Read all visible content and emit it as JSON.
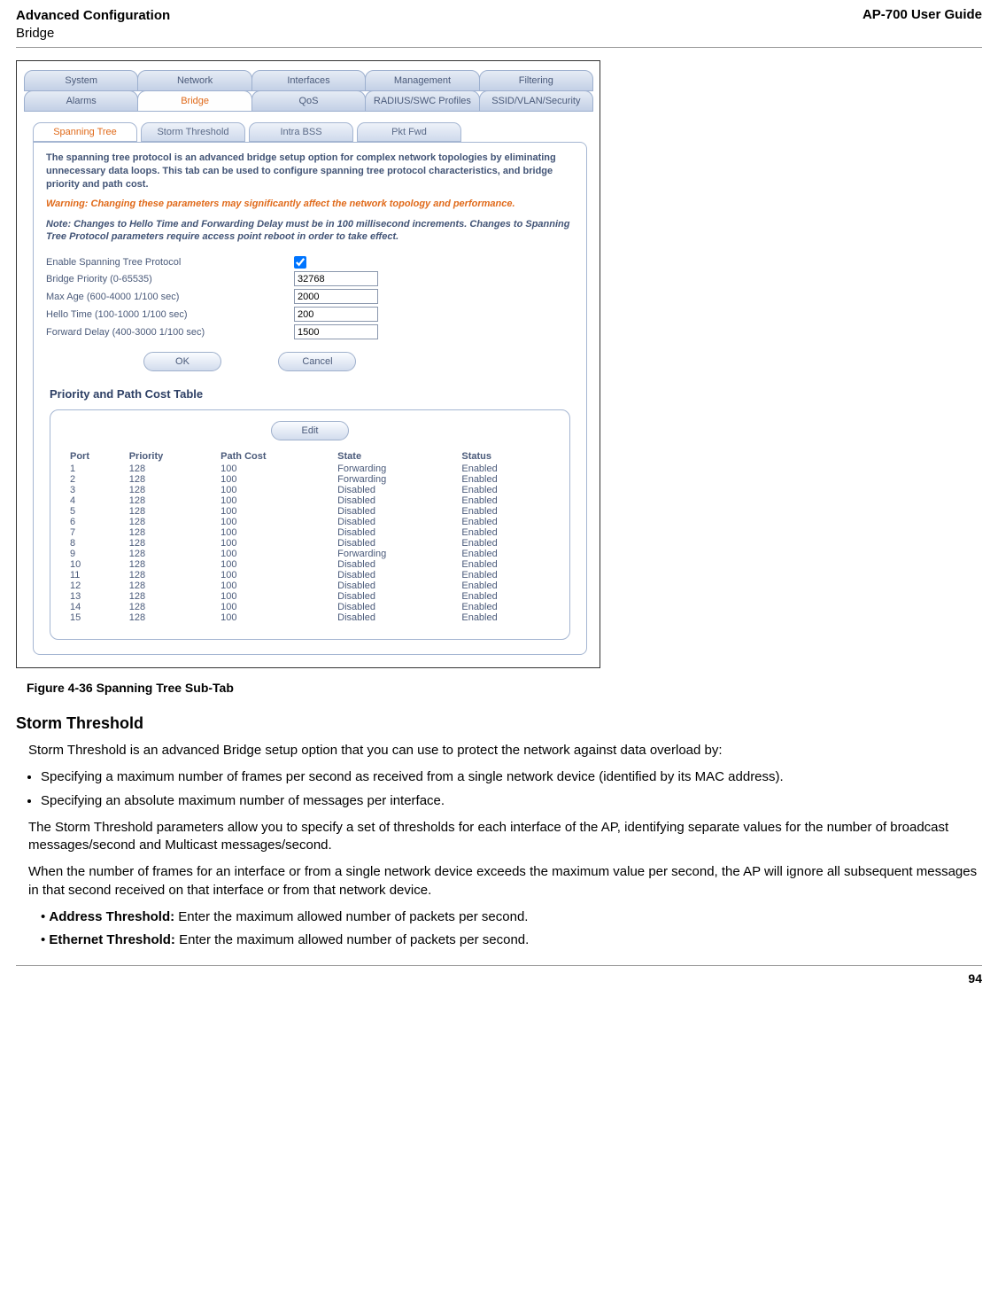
{
  "header": {
    "left_title": "Advanced Configuration",
    "left_sub": "Bridge",
    "right": "AP-700 User Guide"
  },
  "screenshot": {
    "top_tabs_row1": [
      "System",
      "Network",
      "Interfaces",
      "Management",
      "Filtering"
    ],
    "top_tabs_row2": [
      "Alarms",
      "Bridge",
      "QoS",
      "RADIUS/SWC Profiles",
      "SSID/VLAN/Security"
    ],
    "active_top_tab": "Bridge",
    "sub_tabs": [
      "Spanning Tree",
      "Storm Threshold",
      "Intra BSS",
      "Pkt Fwd"
    ],
    "active_sub_tab": "Spanning Tree",
    "intro": "The spanning tree protocol is an advanced bridge setup option for complex network topologies by eliminating unnecessary data loops. This tab can be used to configure spanning tree protocol characteristics, and bridge priority and path cost.",
    "warning": "Warning: Changing these parameters may significantly affect the network topology and performance.",
    "note": "Note: Changes to Hello Time and Forwarding Delay must be in 100 millisecond increments. Changes to Spanning Tree Protocol parameters require access point reboot in order to take effect.",
    "fields": {
      "enable_label": "Enable Spanning Tree Protocol",
      "enable_checked": true,
      "bridge_priority_label": "Bridge Priority (0-65535)",
      "bridge_priority_value": "32768",
      "max_age_label": "Max Age (600-4000 1/100 sec)",
      "max_age_value": "2000",
      "hello_label": "Hello Time (100-1000 1/100 sec)",
      "hello_value": "200",
      "fwd_label": "Forward Delay (400-3000 1/100 sec)",
      "fwd_value": "1500"
    },
    "buttons": {
      "ok": "OK",
      "cancel": "Cancel",
      "edit": "Edit"
    },
    "path_table": {
      "title": "Priority and Path Cost Table",
      "headers": [
        "Port",
        "Priority",
        "Path Cost",
        "State",
        "Status"
      ],
      "rows": [
        [
          "1",
          "128",
          "100",
          "Forwarding",
          "Enabled"
        ],
        [
          "2",
          "128",
          "100",
          "Forwarding",
          "Enabled"
        ],
        [
          "3",
          "128",
          "100",
          "Disabled",
          "Enabled"
        ],
        [
          "4",
          "128",
          "100",
          "Disabled",
          "Enabled"
        ],
        [
          "5",
          "128",
          "100",
          "Disabled",
          "Enabled"
        ],
        [
          "6",
          "128",
          "100",
          "Disabled",
          "Enabled"
        ],
        [
          "7",
          "128",
          "100",
          "Disabled",
          "Enabled"
        ],
        [
          "8",
          "128",
          "100",
          "Disabled",
          "Enabled"
        ],
        [
          "9",
          "128",
          "100",
          "Forwarding",
          "Enabled"
        ],
        [
          "10",
          "128",
          "100",
          "Disabled",
          "Enabled"
        ],
        [
          "11",
          "128",
          "100",
          "Disabled",
          "Enabled"
        ],
        [
          "12",
          "128",
          "100",
          "Disabled",
          "Enabled"
        ],
        [
          "13",
          "128",
          "100",
          "Disabled",
          "Enabled"
        ],
        [
          "14",
          "128",
          "100",
          "Disabled",
          "Enabled"
        ],
        [
          "15",
          "128",
          "100",
          "Disabled",
          "Enabled"
        ]
      ]
    }
  },
  "figure_caption": "Figure 4-36 Spanning Tree Sub-Tab",
  "section_heading": "Storm Threshold",
  "paragraphs": {
    "p1": "Storm Threshold is an advanced Bridge setup option that you can use to protect the network against data overload by:",
    "b1": "Specifying a maximum number of frames per second as received from a single network device (identified by its MAC address).",
    "b2": "Specifying an absolute maximum number of messages per interface.",
    "p2": "The Storm Threshold parameters allow you to specify a set of thresholds for each interface of the AP, identifying separate values for the number of broadcast messages/second and Multicast messages/second.",
    "p3": "When the number of frames for an interface or from a single network device exceeds the maximum value per second, the AP will ignore all subsequent messages in that second received on that interface or from that network device.",
    "li_addr_label": "Address Threshold:",
    "li_addr_text": " Enter the maximum allowed number of packets per second.",
    "li_eth_label": "Ethernet Threshold:",
    "li_eth_text": " Enter the maximum allowed number of packets per second."
  },
  "page_number": "94"
}
